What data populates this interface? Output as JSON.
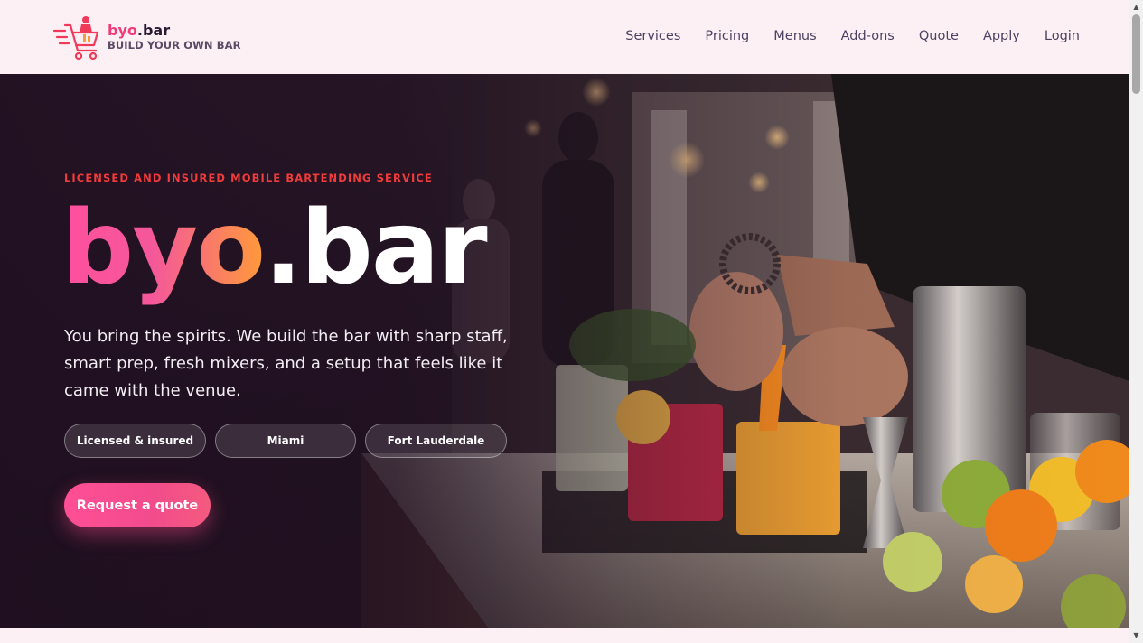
{
  "brand": {
    "name_part1": "byo",
    "name_part2": ".bar",
    "tagline": "BUILD YOUR OWN BAR",
    "logo_icon": "bartender-cart-icon"
  },
  "nav": {
    "items": [
      {
        "label": "Services"
      },
      {
        "label": "Pricing"
      },
      {
        "label": "Menus"
      },
      {
        "label": "Add-ons"
      },
      {
        "label": "Quote"
      },
      {
        "label": "Apply"
      },
      {
        "label": "Login"
      }
    ]
  },
  "hero": {
    "eyebrow": "LICENSED AND INSURED MOBILE BARTENDING SERVICE",
    "title_part1": "byo",
    "title_part2": ".bar",
    "lead": "You bring the spirits. We build the bar with sharp staff, smart prep, fresh mixers, and a setup that feels like it came with the venue.",
    "chips": [
      {
        "label": "Licensed & insured"
      },
      {
        "label": "Miami"
      },
      {
        "label": "Fort Lauderdale"
      }
    ],
    "cta_label": "Request a quote",
    "background_image": "bartender-garnishing-cocktails-photo"
  },
  "colors": {
    "accent_pink": "#f03a7a",
    "accent_orange": "#ff9a3a",
    "eyebrow_red": "#f23b3b",
    "header_bg": "#fdf0f4",
    "nav_text": "#4b4262"
  }
}
